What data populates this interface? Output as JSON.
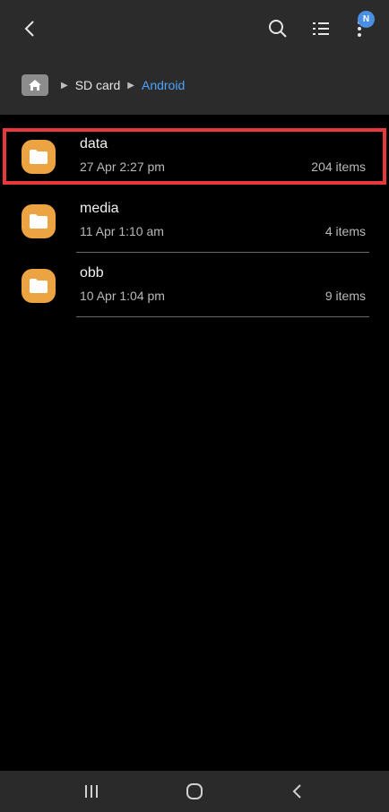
{
  "toolbar": {
    "notification_badge": "N"
  },
  "breadcrumb": {
    "items": [
      {
        "label": "SD card"
      },
      {
        "label": "Android"
      }
    ]
  },
  "folders": [
    {
      "name": "data",
      "date": "27 Apr 2:27 pm",
      "count": "204 items",
      "highlighted": true
    },
    {
      "name": "media",
      "date": "11 Apr 1:10 am",
      "count": "4 items"
    },
    {
      "name": "obb",
      "date": "10 Apr 1:04 pm",
      "count": "9 items"
    }
  ],
  "colors": {
    "accent": "#4da3ff",
    "folder": "#eca443",
    "highlight": "#e8383b",
    "badge": "#4a90e2"
  },
  "icons": {
    "back": "chevron-left-icon",
    "search": "search-icon",
    "list_view": "list-icon",
    "more": "more-vertical-icon",
    "home": "home-icon",
    "folder": "folder-icon",
    "nav_recents": "recents-icon",
    "nav_home": "home-circle-icon",
    "nav_back": "back-arrow-icon"
  }
}
